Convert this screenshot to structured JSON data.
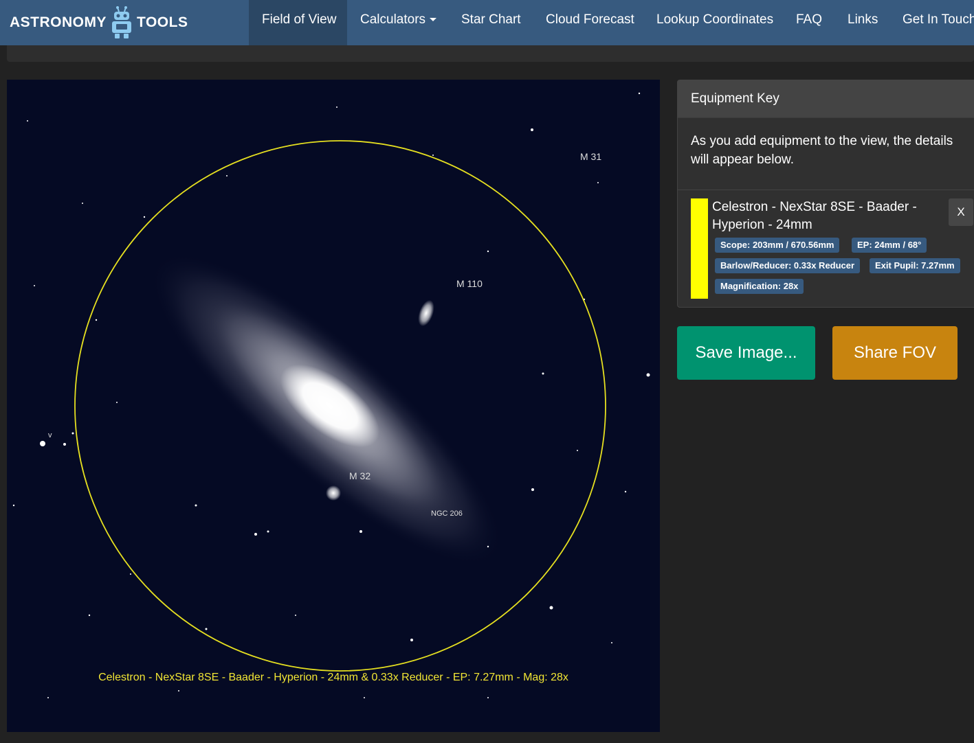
{
  "brand": {
    "left": "ASTRONOMY",
    "right": "TOOLS"
  },
  "nav": {
    "items": [
      {
        "label": "Field of View",
        "active": true
      },
      {
        "label": "Calculators"
      },
      {
        "label": "Star Chart"
      },
      {
        "label": "Cloud Forecast"
      },
      {
        "label": "Lookup Coordinates"
      },
      {
        "label": "FAQ"
      },
      {
        "label": "Links"
      },
      {
        "label": "Get In Touch"
      }
    ]
  },
  "fov": {
    "labels": {
      "m31": "M 31",
      "m110": "M 110",
      "m32": "M 32",
      "ngc206": "NGC 206",
      "v": "v"
    },
    "caption": "Celestron - NexStar 8SE - Baader - Hyperion - 24mm & 0.33x Reducer - EP: 7.27mm - Mag: 28x",
    "circle_color": "#e6e020"
  },
  "equipment_key": {
    "title": "Equipment Key",
    "intro": "As you add equipment to the view, the details will appear below.",
    "item": {
      "color": "#ffff00",
      "name": "Celestron - NexStar 8SE - Baader - Hyperion - 24mm",
      "close_label": "X",
      "badges": {
        "scope": "Scope: 203mm / 670.56mm",
        "ep": "EP: 24mm / 68°",
        "barlow": "Barlow/Reducer: 0.33x Reducer",
        "exit_pupil": "Exit Pupil: 7.27mm",
        "magnification": "Magnification: 28x"
      }
    }
  },
  "actions": {
    "save_label": "Save Image...",
    "share_label": "Share FOV"
  },
  "colors": {
    "navbar": "#375a7f",
    "active_nav": "#2b4764",
    "save": "#00936f",
    "share": "#c8840f",
    "badge": "#375a7f"
  }
}
